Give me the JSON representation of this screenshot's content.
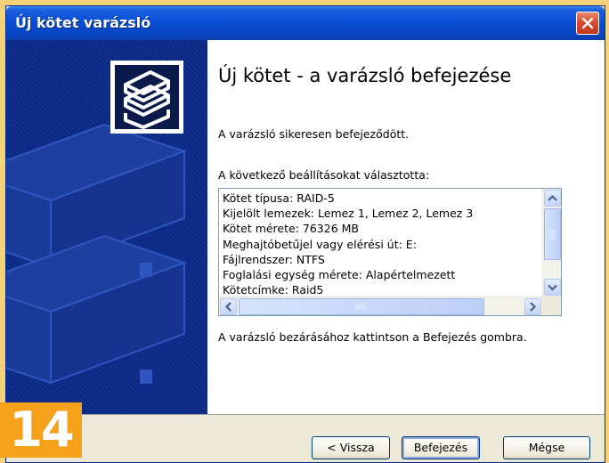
{
  "window": {
    "title": "Új kötet varázsló"
  },
  "content": {
    "heading": "Új kötet - a varázsló befejezése",
    "success_text": "A varázsló sikeresen befejeződött.",
    "settings_label": "A következő beállításokat választotta:",
    "settings_lines": [
      "Kötet típusa: RAID-5",
      "Kijelölt lemezek: Lemez 1, Lemez 2, Lemez 3",
      "Kötet mérete: 76326 MB",
      "Meghajtóbetűjel vagy elérési út: E:",
      "Fájlrendszer: NTFS",
      "Foglalási egység mérete: Alapértelmezett",
      "Kötetcímke: Raid5"
    ],
    "finish_hint": "A varázsló bezárásához kattintson a Befejezés gombra."
  },
  "buttons": {
    "back": "< Vissza",
    "finish": "Befejezés",
    "cancel": "Mégse"
  },
  "badge": "14",
  "colors": {
    "side_panel": "#0b2a86",
    "titlebar": "#0a4fd6",
    "badge": "#f5a21a"
  }
}
